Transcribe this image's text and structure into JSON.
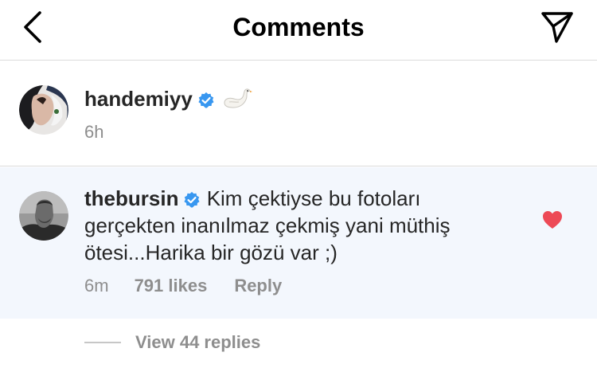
{
  "header": {
    "title": "Comments",
    "back_icon": "chevron-left-icon",
    "send_icon": "paper-plane-icon"
  },
  "caption": {
    "username": "handemiyy",
    "verified": true,
    "emoji_icon": "swan-emoji-icon",
    "time": "6h"
  },
  "comment": {
    "username": "thebursin",
    "verified": true,
    "text": "Kim çektiyse bu fotoları gerçekten inanılmaz çekmiş yani müthiş ötesi...Harika bir gözü var ;)",
    "time": "6m",
    "likes": "791 likes",
    "reply_label": "Reply",
    "liked": true,
    "heart_color": "#ed4956"
  },
  "replies": {
    "label": "View 44 replies"
  },
  "colors": {
    "text": "#262626",
    "muted": "#8e8e8e",
    "divider": "#dbdbdb",
    "highlight_bg": "#f3f7fd",
    "verified_blue": "#3897f0"
  }
}
